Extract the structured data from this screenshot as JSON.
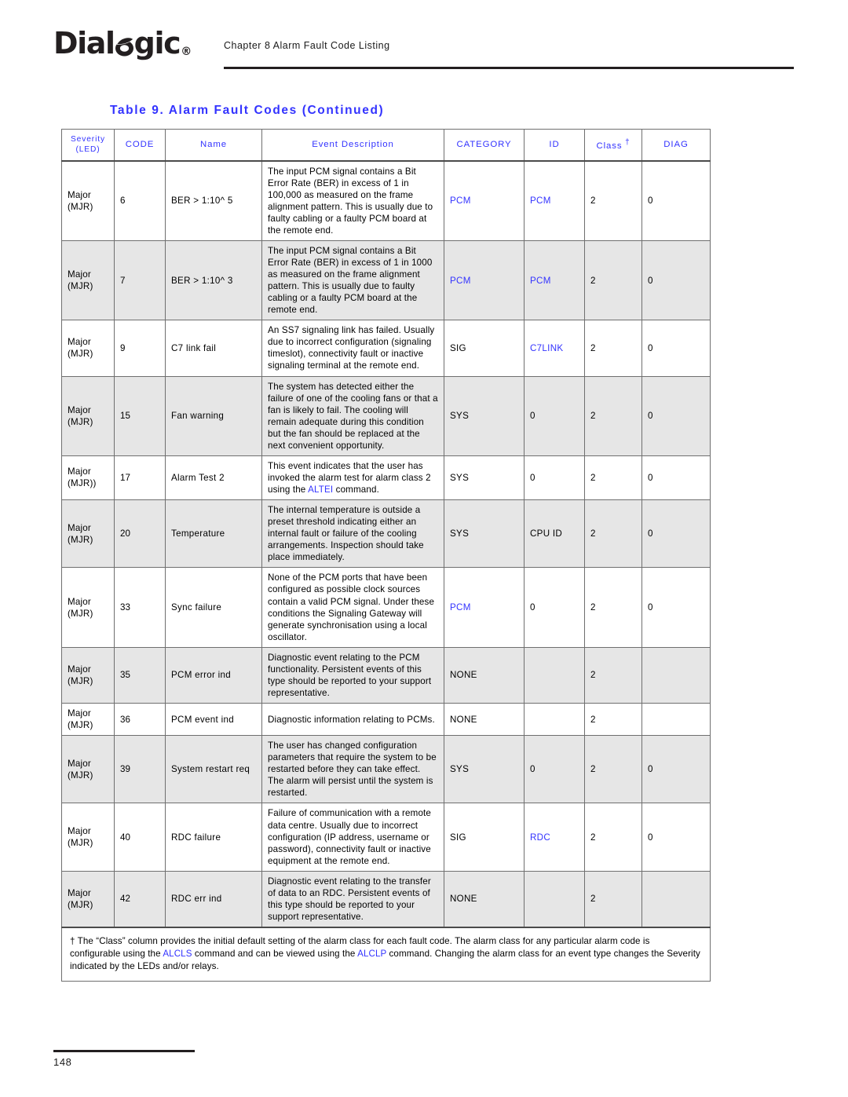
{
  "header": {
    "logo_text_before": "Dial",
    "logo_icon": "dialogic-swoosh-o",
    "logo_text_after": "gic",
    "logo_registered": "®",
    "chapter": "Chapter 8 Alarm Fault Code Listing"
  },
  "table": {
    "caption": "Table 9.  Alarm Fault Codes (Continued)",
    "accent_color": "#3333FF",
    "shade_color": "#E6E6E6",
    "columns": [
      {
        "label": "Severity\n(LED)",
        "key": "severity"
      },
      {
        "label": "CODE",
        "key": "code"
      },
      {
        "label": "Name",
        "key": "name"
      },
      {
        "label": "Event Description",
        "key": "description"
      },
      {
        "label": "CATEGORY",
        "key": "category"
      },
      {
        "label": "ID",
        "key": "id"
      },
      {
        "label": "Class",
        "key": "class",
        "suffix": "†"
      },
      {
        "label": "DIAG",
        "key": "diag"
      }
    ],
    "rows": [
      {
        "severity": "Major\n(MJR)",
        "code": "6",
        "name": "BER > 1:10^ 5",
        "description": "The input PCM signal contains a Bit Error Rate (BER) in excess of 1 in 100,000 as measured on the frame alignment pattern. This is usually due to faulty cabling or a faulty PCM board at the remote end.",
        "category": "PCM",
        "category_blue": true,
        "id": "PCM",
        "id_blue": true,
        "class": "2",
        "diag": "0",
        "shaded": false
      },
      {
        "severity": "Major\n(MJR)",
        "code": "7",
        "name": "BER > 1:10^ 3",
        "description": "The input PCM signal contains a Bit Error Rate (BER) in excess of 1 in 1000 as measured on the frame alignment pattern. This is usually due to faulty cabling or a faulty PCM board at the remote end.",
        "category": "PCM",
        "category_blue": true,
        "id": "PCM",
        "id_blue": true,
        "class": "2",
        "diag": "0",
        "shaded": true
      },
      {
        "severity": "Major\n(MJR)",
        "code": "9",
        "name": "C7 link fail",
        "description": "An SS7 signaling link has failed. Usually due to incorrect configuration (signaling timeslot), connectivity fault or inactive signaling terminal at the remote end.",
        "category": "SIG",
        "category_blue": false,
        "id": "C7LINK",
        "id_blue": true,
        "class": "2",
        "diag": "0",
        "shaded": false
      },
      {
        "severity": "Major\n(MJR)",
        "code": "15",
        "name": "Fan warning",
        "description": "The system has detected either the failure of one of the cooling fans or that a fan is likely to fail. The cooling will remain adequate during this condition but the fan should be replaced at the next convenient opportunity.",
        "category": "SYS",
        "category_blue": false,
        "id": "0",
        "id_blue": false,
        "class": "2",
        "diag": "0",
        "shaded": true
      },
      {
        "severity": "Major\n(MJR))",
        "code": "17",
        "name": "Alarm Test 2",
        "description_parts": [
          {
            "text": "This event indicates that the user has invoked the alarm test for alarm class 2 using the ",
            "blue": false
          },
          {
            "text": "ALTEI",
            "blue": true
          },
          {
            "text": " command.",
            "blue": false
          }
        ],
        "description": "This event indicates that the user has invoked the alarm test for alarm class 2 using the ALTEI command.",
        "category": "SYS",
        "category_blue": false,
        "id": "0",
        "id_blue": false,
        "class": "2",
        "diag": "0",
        "shaded": false
      },
      {
        "severity": "Major\n(MJR)",
        "code": "20",
        "name": "Temperature",
        "description": "The internal temperature is outside a preset threshold indicating either an internal fault or failure of the cooling arrangements. Inspection should take place immediately.",
        "category": "SYS",
        "category_blue": false,
        "id": "CPU ID",
        "id_blue": false,
        "class": "2",
        "diag": "0",
        "shaded": true
      },
      {
        "severity": "Major\n(MJR)",
        "code": "33",
        "name": "Sync failure",
        "description": "None of the PCM ports that have been configured as possible clock sources contain a valid PCM signal. Under these conditions the Signaling Gateway will generate synchronisation using a local oscillator.",
        "category": "PCM",
        "category_blue": true,
        "id": "0",
        "id_blue": false,
        "class": "2",
        "diag": "0",
        "shaded": false
      },
      {
        "severity": "Major\n(MJR)",
        "code": "35",
        "name": "PCM error ind",
        "description": "Diagnostic event relating to the PCM functionality. Persistent events of this type should be reported to your support representative.",
        "category": "NONE",
        "category_blue": false,
        "id": "",
        "id_blue": false,
        "class": "2",
        "diag": "",
        "shaded": true
      },
      {
        "severity": "Major\n(MJR)",
        "code": "36",
        "name": "PCM event ind",
        "description": "Diagnostic information relating to PCMs.",
        "category": "NONE",
        "category_blue": false,
        "id": "",
        "id_blue": false,
        "class": "2",
        "diag": "",
        "shaded": false
      },
      {
        "severity": "Major\n(MJR)",
        "code": "39",
        "name": "System restart req",
        "description": "The user has changed configuration parameters that require the system to be restarted before they can take effect. The alarm will persist until the system is restarted.",
        "category": "SYS",
        "category_blue": false,
        "id": "0",
        "id_blue": false,
        "class": "2",
        "diag": "0",
        "shaded": true
      },
      {
        "severity": "Major\n(MJR)",
        "code": "40",
        "name": "RDC failure",
        "description": "Failure of communication with a remote data centre. Usually due to incorrect configuration (IP address, username or password), connectivity fault or inactive equipment at the remote end.",
        "category": "SIG",
        "category_blue": false,
        "id": "RDC",
        "id_blue": true,
        "class": "2",
        "diag": "0",
        "shaded": false
      },
      {
        "severity": "Major\n(MJR)",
        "code": "42",
        "name": "RDC err ind",
        "description": "Diagnostic event relating to the transfer of data to an RDC. Persistent events of this type should be reported to your support representative.",
        "category": "NONE",
        "category_blue": false,
        "id": "",
        "id_blue": false,
        "class": "2",
        "diag": "",
        "shaded": true
      }
    ],
    "footnote_parts": [
      {
        "text": "† The “Class” column provides the initial default setting of the alarm class for each fault code. The alarm class for any particular alarm code is configurable using the ",
        "blue": false
      },
      {
        "text": "ALCLS",
        "blue": true
      },
      {
        "text": " command and can be viewed using the ",
        "blue": false
      },
      {
        "text": "ALCLP",
        "blue": true
      },
      {
        "text": " command. Changing the alarm class for an event type changes the Severity indicated by the LEDs and/or relays.",
        "blue": false
      }
    ],
    "footnote": "† The “Class” column provides the initial default setting of the alarm class for each fault code. The alarm class for any particular alarm code is configurable using the ALCLS command and can be viewed using the ALCLP command. Changing the alarm class for an event type changes the Severity indicated by the LEDs and/or relays."
  },
  "footer": {
    "page_number": "148"
  }
}
